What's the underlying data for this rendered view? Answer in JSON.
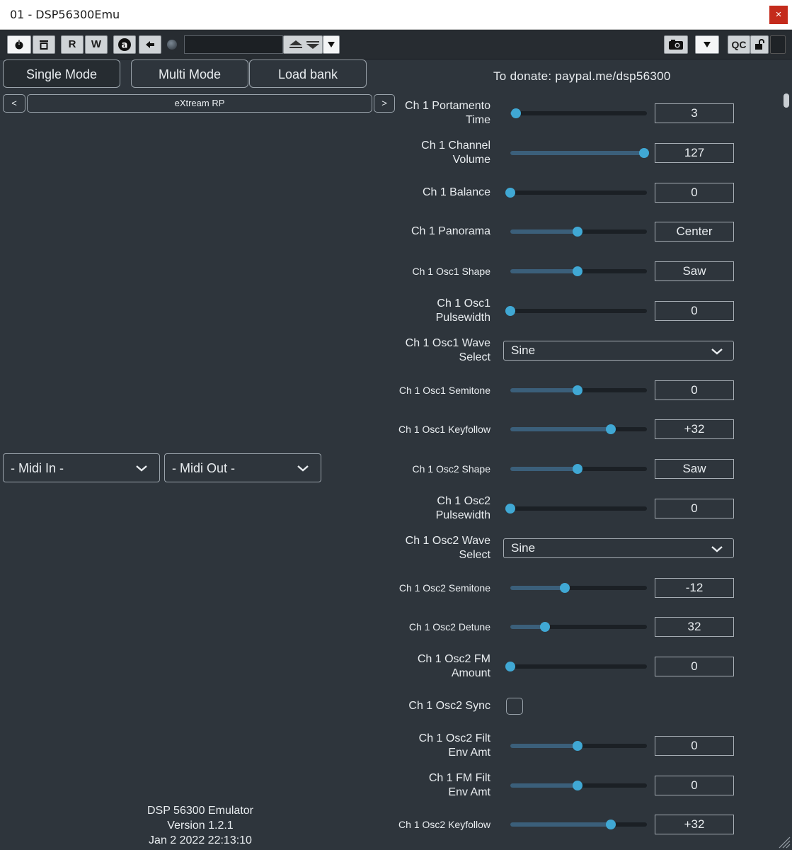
{
  "window": {
    "title": "01 - DSP56300Emu",
    "close_glyph": "×"
  },
  "toolbar": {
    "power_icon": "power-icon",
    "compare_icon": "compare-icon",
    "read_label": "R",
    "write_label": "W",
    "auto_label": "a",
    "back_icon": "arrow-left-icon",
    "preset_field_value": "",
    "qc_label": "QC",
    "camera_icon": "camera-icon",
    "lock_icon": "lock-open-icon"
  },
  "modes": {
    "single": "Single Mode",
    "multi": "Multi Mode",
    "load_bank": "Load bank"
  },
  "donate": "To donate: paypal.me/dsp56300",
  "preset": {
    "prev": "<",
    "name": "eXtream RP",
    "next": ">"
  },
  "midi": {
    "in": "- Midi In -",
    "out": "- Midi Out -"
  },
  "params": [
    {
      "label1": "Ch 1 Portamento",
      "label2": "Time",
      "kind": "slider",
      "level": 0.04,
      "value": "3"
    },
    {
      "label1": "Ch 1 Channel",
      "label2": "Volume",
      "kind": "slider",
      "level": 1.0,
      "value": "127"
    },
    {
      "label1": "Ch 1 Balance",
      "label2": "",
      "kind": "slider",
      "level": 0.0,
      "value": "0"
    },
    {
      "label1": "Ch 1 Panorama",
      "label2": "",
      "kind": "slider",
      "level": 0.5,
      "value": "Center"
    },
    {
      "label1": "Ch 1 Osc1 Shape",
      "label2": "",
      "kind": "slider",
      "small": true,
      "level": 0.5,
      "value": "Saw"
    },
    {
      "label1": "Ch 1 Osc1",
      "label2": "Pulsewidth",
      "kind": "slider",
      "level": 0.0,
      "value": "0"
    },
    {
      "label1": "Ch 1 Osc1 Wave",
      "label2": "Select",
      "kind": "select",
      "value": "Sine"
    },
    {
      "label1": "Ch 1 Osc1 Semitone",
      "label2": "",
      "kind": "slider",
      "small": true,
      "level": 0.5,
      "value": "0"
    },
    {
      "label1": "Ch 1 Osc1 Keyfollow",
      "label2": "",
      "kind": "slider",
      "small": true,
      "level": 0.75,
      "value": "+32"
    },
    {
      "label1": "Ch 1 Osc2 Shape",
      "label2": "",
      "kind": "slider",
      "small": true,
      "level": 0.5,
      "value": "Saw"
    },
    {
      "label1": "Ch 1 Osc2",
      "label2": "Pulsewidth",
      "kind": "slider",
      "level": 0.0,
      "value": "0"
    },
    {
      "label1": "Ch 1 Osc2 Wave",
      "label2": "Select",
      "kind": "select",
      "value": "Sine"
    },
    {
      "label1": "Ch 1 Osc2 Semitone",
      "label2": "",
      "kind": "slider",
      "small": true,
      "level": 0.41,
      "value": "-12"
    },
    {
      "label1": "Ch 1 Osc2 Detune",
      "label2": "",
      "kind": "slider",
      "small": true,
      "level": 0.26,
      "value": "32"
    },
    {
      "label1": "Ch 1 Osc2 FM",
      "label2": "Amount",
      "kind": "slider",
      "level": 0.0,
      "value": "0"
    },
    {
      "label1": "Ch 1 Osc2 Sync",
      "label2": "",
      "kind": "checkbox",
      "checked": false
    },
    {
      "label1": "Ch 1 Osc2 Filt",
      "label2": "Env Amt",
      "kind": "slider",
      "level": 0.5,
      "value": "0"
    },
    {
      "label1": "Ch 1 FM Filt",
      "label2": "Env Amt",
      "kind": "slider",
      "level": 0.5,
      "value": "0"
    },
    {
      "label1": "Ch 1 Osc2 Keyfollow",
      "label2": "",
      "kind": "slider",
      "small": true,
      "level": 0.75,
      "value": "+32"
    }
  ],
  "footer": {
    "line1": "DSP 56300 Emulator",
    "line2": "Version 1.2.1",
    "line3": "Jan  2 2022 22:13:10"
  },
  "colors": {
    "background": "#2e353c",
    "accent": "#40a8d4",
    "close": "#c42b1c"
  }
}
